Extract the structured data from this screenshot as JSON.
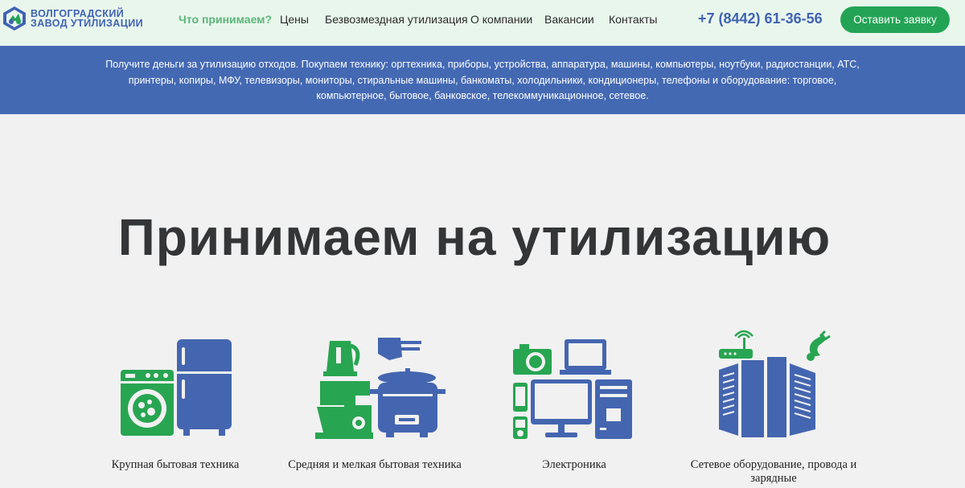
{
  "header": {
    "logo_line1": "ВОЛГОГРАДСКИЙ",
    "logo_line2": "ЗАВОД УТИЛИЗАЦИИ",
    "nav": [
      {
        "label": "Что принимаем?",
        "active": true
      },
      {
        "label": "Цены"
      },
      {
        "label": "Безвозмездная утилизация"
      },
      {
        "label": "О компании"
      },
      {
        "label": "Вакансии"
      },
      {
        "label": "Контакты"
      }
    ],
    "phone": "+7 (8442) 61-36-56",
    "cta_label": "Оставить заявку"
  },
  "banner": {
    "text": "Получите деньги за утилизацию отходов. Покупаем технику: оргтехника, приборы, устройства, аппаратура, машины, компьютеры, ноутбуки, радиостанции, АТС, принтеры, копиры, МФУ, телевизоры, мониторы, стиральные машины, банкоматы, холодильники, кондиционеры, телефоны и оборудование: торговое, компьютерное, бытовое, банковское, телекоммуникационное, сетевое."
  },
  "main": {
    "title": "Принимаем на утилизацию",
    "categories": [
      {
        "label": "Крупная бытовая техника",
        "icon": "washer-fridge-icon"
      },
      {
        "label": "Средняя и мелкая бытовая техника",
        "icon": "kitchen-appliances-icon"
      },
      {
        "label": "Электроника",
        "icon": "electronics-icon"
      },
      {
        "label": "Сетевое оборудование, провода и зарядные",
        "icon": "network-equipment-icon"
      }
    ]
  },
  "colors": {
    "accent_green": "#23a455",
    "nav_active": "#5bb77b",
    "brand_blue": "#3f63b3",
    "banner_bg": "#4469b3",
    "icon_green": "#28a551",
    "icon_blue": "#4466b0",
    "header_bg": "#e9f6ec",
    "page_bg": "#f1f1f1"
  }
}
